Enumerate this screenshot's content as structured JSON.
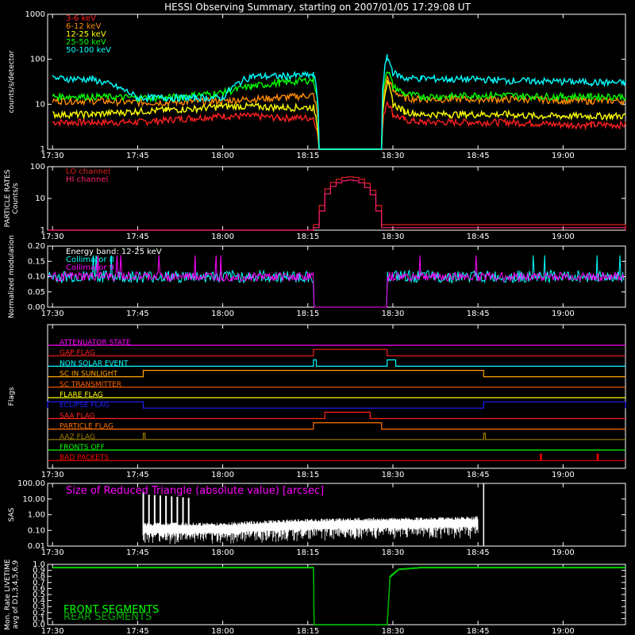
{
  "title": "HESSI Observing Summary, starting on 2007/01/05 17:29:08 UT",
  "time_axis": {
    "start": "17:29:08",
    "end": "19:11:00",
    "tick_labels": [
      "17:30",
      "17:45",
      "18:00",
      "18:15",
      "18:30",
      "18:45",
      "19:00"
    ]
  },
  "chart_data": [
    {
      "type": "line",
      "ylabel": "counts/s/detector",
      "yscale": "log",
      "ylim": [
        1,
        1000
      ],
      "ytick_labels": [
        "1",
        "10",
        "100",
        "1000"
      ],
      "x": [
        "17:30",
        "17:37",
        "17:45",
        "17:50",
        "17:55",
        "18:00",
        "18:05",
        "18:10",
        "18:16",
        "18:17",
        "18:28",
        "18:29",
        "18:30",
        "18:32",
        "18:35",
        "18:40",
        "18:45",
        "18:50",
        "18:55",
        "19:00",
        "19:05",
        "19:11"
      ],
      "series": [
        {
          "name": "3-6 keV",
          "color": "#ff2020",
          "values": [
            4,
            4,
            4,
            4.5,
            5,
            5.5,
            5.5,
            5,
            5,
            1,
            1,
            12,
            6,
            4.5,
            4,
            4,
            4,
            4,
            3.8,
            3.5,
            3.5,
            3.5
          ]
        },
        {
          "name": "6-12 keV",
          "color": "#ff8c00",
          "values": [
            12,
            12,
            11,
            11,
            11.5,
            12,
            13,
            14,
            16,
            1,
            1,
            40,
            20,
            14,
            13,
            13,
            13,
            13,
            13,
            12,
            12,
            12
          ]
        },
        {
          "name": "12-25 keV",
          "color": "#ffff00",
          "values": [
            6,
            6,
            7,
            7.5,
            8,
            9,
            9,
            8.5,
            8.5,
            1,
            1,
            30,
            10,
            7,
            6,
            6,
            6,
            6,
            5.5,
            5.5,
            5.5,
            5.5
          ]
        },
        {
          "name": "25-50 keV",
          "color": "#00ff00",
          "values": [
            15,
            15,
            14,
            14,
            16,
            18,
            25,
            30,
            35,
            1,
            1,
            60,
            25,
            17,
            15,
            15,
            16,
            16,
            15,
            15,
            15,
            15
          ]
        },
        {
          "name": "50-100 keV",
          "color": "#00ffff",
          "values": [
            38,
            36,
            14,
            14,
            14,
            14,
            42,
            42,
            45,
            1,
            1,
            110,
            50,
            38,
            38,
            36,
            36,
            34,
            33,
            32,
            31,
            30
          ]
        }
      ]
    },
    {
      "type": "line",
      "ylabel": "PARTICLE RATES Counts/s",
      "yscale": "log",
      "ylim": [
        1,
        100
      ],
      "ytick_labels": [
        "1",
        "10",
        "100"
      ],
      "x": [
        "18:16",
        "18:17",
        "18:18",
        "18:19",
        "18:20",
        "18:21",
        "18:22",
        "18:23",
        "18:24",
        "18:25",
        "18:26",
        "18:27",
        "18:28"
      ],
      "series": [
        {
          "name": "LO channel",
          "color": "#dd2020",
          "values": [
            1.5,
            6,
            20,
            32,
            40,
            46,
            48,
            46,
            40,
            30,
            18,
            6,
            1.5
          ]
        },
        {
          "name": "HI channel",
          "color": "#ff2070",
          "values": [
            1.2,
            4,
            14,
            24,
            31,
            36,
            38,
            36,
            31,
            22,
            13,
            4,
            1.2
          ]
        }
      ]
    },
    {
      "type": "line",
      "ylabel": "Normalized modulation",
      "yscale": "linear",
      "ylim": [
        0.0,
        0.2
      ],
      "ytick_labels": [
        "0.00",
        "0.05",
        "0.10",
        "0.15",
        "0.20"
      ],
      "annotations": [
        "Energy band: 12-25 keV"
      ],
      "series": [
        {
          "name": "Collimator 8",
          "color": "#00ffff",
          "mean": 0.1,
          "scatter": 0.02
        },
        {
          "name": "Collimator 9",
          "color": "#ff00ff",
          "mean": 0.1,
          "scatter": 0.015
        }
      ],
      "gap": [
        "18:16",
        "18:29"
      ]
    },
    {
      "type": "line",
      "ylabel": "Flags",
      "flags": [
        {
          "name": "ATTENUATOR STATE",
          "color": "#ff00ff",
          "on": []
        },
        {
          "name": "GAP FLAG",
          "color": "#ff2020",
          "on": [
            [
              "18:16",
              "18:29"
            ]
          ]
        },
        {
          "name": "NON SOLAR EVENT",
          "color": "#00ffff",
          "on": [
            [
              "18:16",
              "18:16.5"
            ],
            [
              "18:29",
              "18:30.5"
            ]
          ]
        },
        {
          "name": "SC IN SUNLIGHT",
          "color": "#ffa000",
          "on": [
            [
              "17:46",
              "18:46"
            ]
          ]
        },
        {
          "name": "SC TRANSMITTER",
          "color": "#ff6000",
          "on": []
        },
        {
          "name": "FLARE FLAG",
          "color": "#ffff00",
          "on": []
        },
        {
          "name": "ECLIPSE FLAG",
          "color": "#2020ff",
          "on": [
            [
              "17:29",
              "17:46"
            ],
            [
              "18:46",
              "19:11"
            ]
          ]
        },
        {
          "name": "SAA FLAG",
          "color": "#ff2020",
          "on": [
            [
              "18:18",
              "18:26"
            ]
          ]
        },
        {
          "name": "PARTICLE FLAG",
          "color": "#ff7000",
          "on": [
            [
              "18:16",
              "18:28"
            ]
          ]
        },
        {
          "name": "AAZ FLAG",
          "color": "#a08000",
          "on": [
            [
              "17:46",
              "17:46.3"
            ],
            [
              "18:46",
              "18:46.3"
            ]
          ]
        },
        {
          "name": "FRONTS OFF",
          "color": "#00ff00",
          "on": []
        },
        {
          "name": "BAD PACKETS",
          "color": "#ff0000",
          "on": [
            [
              "18:56",
              "18:56.2"
            ],
            [
              "19:06",
              "19:06.2"
            ]
          ]
        }
      ]
    },
    {
      "type": "line",
      "ylabel": "SAS",
      "yscale": "log",
      "ylim": [
        0.01,
        100
      ],
      "ytick_labels": [
        "0.01",
        "0.10",
        "1.00",
        "10.00",
        "100.00"
      ],
      "legend": "Size of Reduced Triangle (absolute value) [arcsec]",
      "series": [
        {
          "name": "Size of Reduced Triangle",
          "color": "#ffffff",
          "x": [
            "17:46",
            "17:50",
            "17:55",
            "18:00",
            "18:05",
            "18:10",
            "18:15",
            "18:20",
            "18:30",
            "18:40",
            "18:45",
            "18:46"
          ],
          "values": [
            0.2,
            0.2,
            0.2,
            0.2,
            0.25,
            0.3,
            0.35,
            0.38,
            0.42,
            0.45,
            0.5,
            100
          ]
        }
      ]
    },
    {
      "type": "line",
      "ylabel": "Mon. Rate LIVETIME avg of D1,3,4,5,6,9",
      "yscale": "linear",
      "ylim": [
        0.0,
        1.0
      ],
      "ytick_labels": [
        "0.0",
        "0.1",
        "0.2",
        "0.3",
        "0.4",
        "0.5",
        "0.6",
        "0.7",
        "0.8",
        "0.9",
        "1.0"
      ],
      "series": [
        {
          "name": "FRONT SEGMENTS",
          "color": "#00ff00",
          "values_note": "",
          "x": [
            "17:30",
            "18:16",
            "18:16.1",
            "18:29",
            "18:29.5",
            "18:31",
            "18:35",
            "19:11"
          ],
          "values": [
            0.95,
            0.95,
            0.0,
            0.0,
            0.8,
            0.92,
            0.95,
            0.95
          ]
        },
        {
          "name": "REAR SEGMENTS",
          "color": "#00aa00",
          "x": [
            "17:30",
            "18:16",
            "18:16.1",
            "18:29",
            "18:29.5",
            "18:31",
            "18:35",
            "19:11"
          ],
          "values": [
            0.94,
            0.94,
            0.0,
            0.0,
            0.78,
            0.91,
            0.94,
            0.94
          ]
        }
      ]
    }
  ]
}
